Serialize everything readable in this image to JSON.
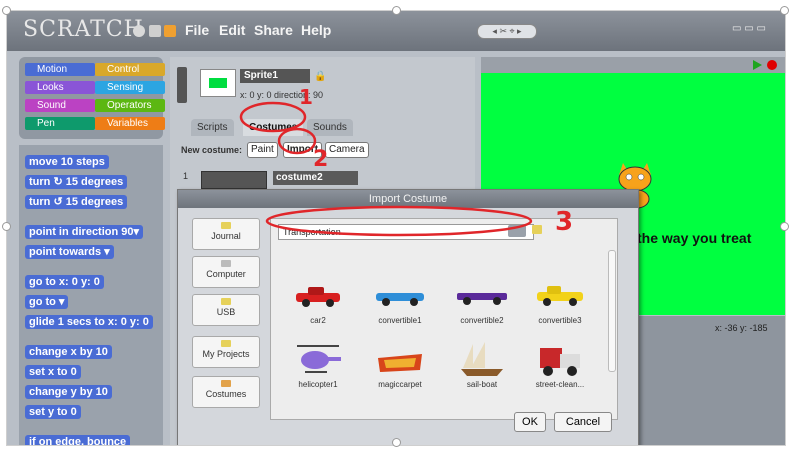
{
  "app": {
    "logo": "SCRATCH",
    "menus": [
      "File",
      "Edit",
      "Share",
      "Help"
    ]
  },
  "categories": [
    "Motion",
    "Control",
    "Looks",
    "Sensing",
    "Sound",
    "Operators",
    "Pen",
    "Variables"
  ],
  "blocks": [
    "move 10 steps",
    "turn ↻ 15 degrees",
    "turn ↺ 15 degrees",
    "point in direction 90▾",
    "point towards ▾",
    "go to x: 0 y: 0",
    "go to ▾",
    "glide 1 secs to x: 0 y: 0",
    "change x by 10",
    "set x to 0",
    "change y by 10",
    "set y to 0",
    "if on edge, bounce"
  ],
  "sprite": {
    "name": "Sprite1",
    "coords": "x: 0   y: 0   direction: 90"
  },
  "tabs": [
    "Scripts",
    "Costumes",
    "Sounds"
  ],
  "new_costume": {
    "label": "New costume:",
    "buttons": [
      "Paint",
      "Import",
      "Camera"
    ]
  },
  "costume_item": {
    "index": "1",
    "name": "costume2"
  },
  "stage": {
    "text": "the way you treat",
    "xy": "x: -36   y: -185"
  },
  "dialog": {
    "title": "Import Costume",
    "sidebar": [
      "Journal",
      "Computer",
      "USB",
      "My Projects",
      "Costumes"
    ],
    "folder": "Transportation",
    "items": [
      "car2",
      "convertible1",
      "convertible2",
      "convertible3",
      "helicopter1",
      "magiccarpet",
      "sail-boat",
      "street-clean..."
    ],
    "ok": "OK",
    "cancel": "Cancel"
  },
  "annotations": {
    "n1": "1",
    "n2": "2",
    "n3": "3"
  },
  "colors": {
    "stage": "#00ff40",
    "motion_block": "#4a6cd4",
    "annotation": "#e0262a"
  }
}
